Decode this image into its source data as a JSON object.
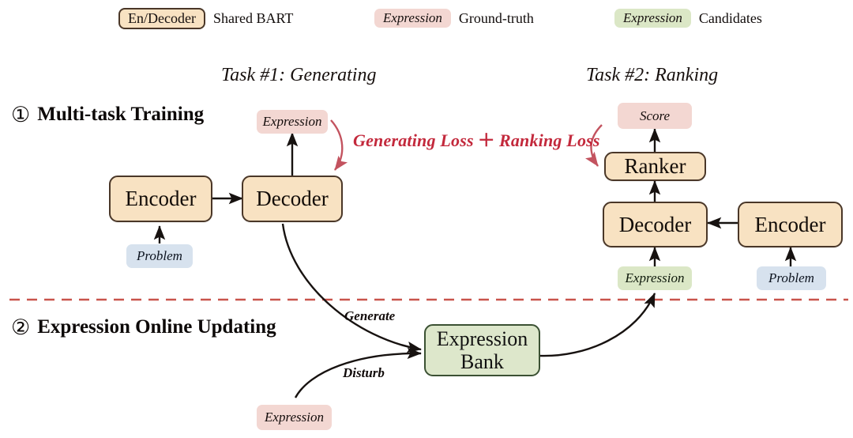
{
  "legend": {
    "items": [
      {
        "chip": "En/Decoder",
        "label": "Shared BART",
        "style": "boxed"
      },
      {
        "chip": "Expression",
        "label": "Ground-truth",
        "style": "pink"
      },
      {
        "chip": "Expression",
        "label": "Candidates",
        "style": "green"
      }
    ]
  },
  "tasks": {
    "left_title": "Task #1: Generating",
    "right_title": "Task #2: Ranking"
  },
  "stages": [
    {
      "number": "①",
      "title": "Multi-task Training"
    },
    {
      "number": "②",
      "title": "Expression Online Updating"
    }
  ],
  "loss": {
    "left": "Generating Loss",
    "plus": "＋",
    "right": "Ranking Loss"
  },
  "nodes": {
    "encoder_left": "Encoder",
    "decoder_left": "Decoder",
    "problem_left": "Problem",
    "expression_gt_left": "Expression",
    "score": "Score",
    "ranker": "Ranker",
    "decoder_right": "Decoder",
    "encoder_right": "Encoder",
    "expression_cand_right": "Expression",
    "problem_right": "Problem",
    "expression_bank_line1": "Expression",
    "expression_bank_line2": "Bank",
    "expression_disturb": "Expression"
  },
  "edges": {
    "generate": "Generate",
    "disturb": "Disturb"
  },
  "colors": {
    "module_fill": "#f8e2c2",
    "module_border": "#4a3728",
    "bank_fill": "#dde7cb",
    "bank_border": "#3b5133",
    "tag_pink": "#f3d7d2",
    "tag_green": "#dbe7c6",
    "tag_blue": "#d7e2ee",
    "loss_red": "#c3293c",
    "divider_red": "#c9544c",
    "arrow_black": "#171210"
  }
}
